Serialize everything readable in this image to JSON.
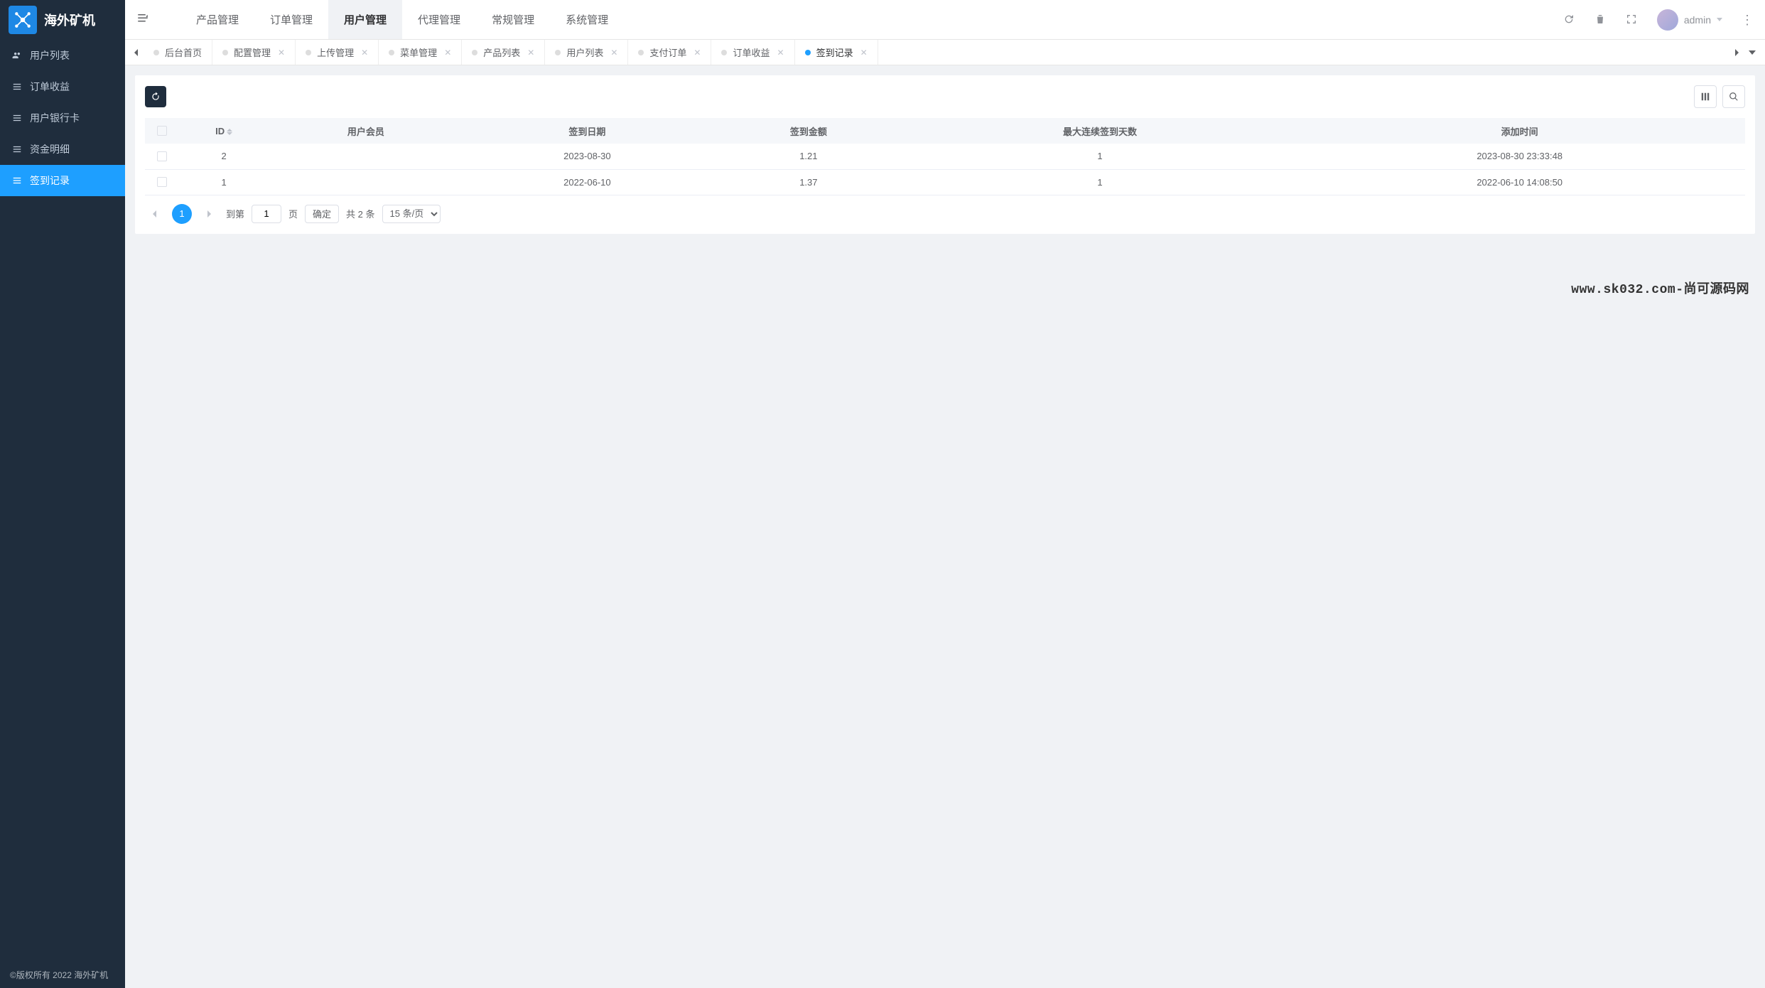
{
  "brand": {
    "name": "海外矿机"
  },
  "sidebar": {
    "items": [
      {
        "label": "用户列表"
      },
      {
        "label": "订单收益"
      },
      {
        "label": "用户银行卡"
      },
      {
        "label": "资金明细"
      },
      {
        "label": "签到记录"
      }
    ]
  },
  "header": {
    "nav": [
      {
        "label": "产品管理"
      },
      {
        "label": "订单管理"
      },
      {
        "label": "用户管理"
      },
      {
        "label": "代理管理"
      },
      {
        "label": "常规管理"
      },
      {
        "label": "系统管理"
      }
    ],
    "user": "admin"
  },
  "tabs": [
    {
      "label": "后台首页",
      "closable": false
    },
    {
      "label": "配置管理",
      "closable": true
    },
    {
      "label": "上传管理",
      "closable": true
    },
    {
      "label": "菜单管理",
      "closable": true
    },
    {
      "label": "产品列表",
      "closable": true
    },
    {
      "label": "用户列表",
      "closable": true
    },
    {
      "label": "支付订单",
      "closable": true
    },
    {
      "label": "订单收益",
      "closable": true
    },
    {
      "label": "签到记录",
      "closable": true
    }
  ],
  "table": {
    "columns": [
      {
        "label": "ID"
      },
      {
        "label": "用户会员"
      },
      {
        "label": "签到日期"
      },
      {
        "label": "签到金额"
      },
      {
        "label": "最大连续签到天数"
      },
      {
        "label": "添加时间"
      }
    ],
    "rows": [
      {
        "id": "2",
        "member": "",
        "date": "2023-08-30",
        "amount": "1.21",
        "maxdays": "1",
        "created": "2023-08-30 23:33:48"
      },
      {
        "id": "1",
        "member": "",
        "date": "2022-06-10",
        "amount": "1.37",
        "maxdays": "1",
        "created": "2022-06-10 14:08:50"
      }
    ]
  },
  "pagination": {
    "current_page": "1",
    "goto_label": "到第",
    "page_input": "1",
    "page_suffix": "页",
    "confirm": "确定",
    "total": "共 2 条",
    "per_page": "15 条/页"
  },
  "footer": "©版权所有 2022 海外矿机",
  "watermark": "www.sk032.com-尚可源码网"
}
